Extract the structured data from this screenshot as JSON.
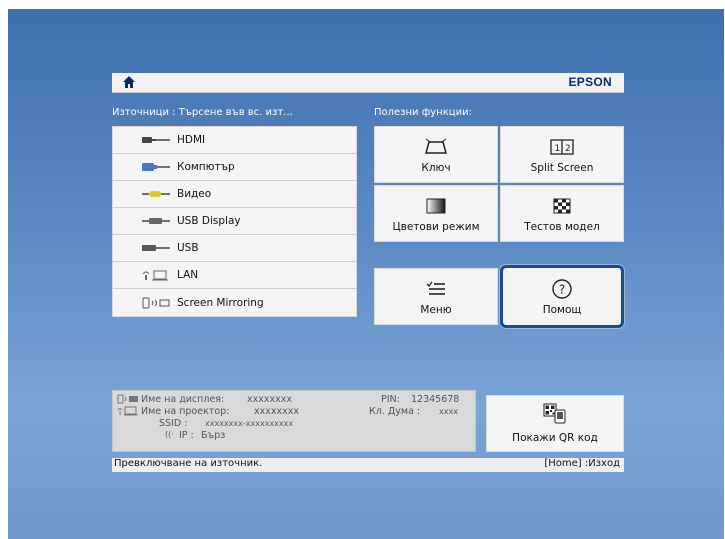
{
  "header": {
    "brand": "EPSON",
    "home_icon": "home-icon"
  },
  "sources": {
    "heading": "Източници : Търсене във вс. изт...",
    "items": [
      {
        "label": "HDMI",
        "icon": "hdmi-icon"
      },
      {
        "label": "Компютър",
        "icon": "computer-icon"
      },
      {
        "label": "Видео",
        "icon": "video-icon"
      },
      {
        "label": "USB Display",
        "icon": "usb-display-icon"
      },
      {
        "label": "USB",
        "icon": "usb-icon"
      },
      {
        "label": "LAN",
        "icon": "lan-icon"
      },
      {
        "label": "Screen Mirroring",
        "icon": "screen-mirroring-icon"
      }
    ]
  },
  "functions": {
    "heading": "Полезни функции:",
    "keystone": "Ключ",
    "split_screen": "Split Screen",
    "color_mode": "Цветови режим",
    "test_pattern": "Тестов модел",
    "menu": "Меню",
    "help": "Помощ",
    "help_icon_glyph": "?",
    "selected": "help"
  },
  "info": {
    "display_name_label": "Име на дисплея:",
    "display_name_value": "xxxxxxxx",
    "projector_name_label": "Име на проектор:",
    "projector_name_value": "xxxxxxxx",
    "ssid_label": "SSID :",
    "ssid_value": "xxxxxxxx-xxxxxxxxxx",
    "ip_label": "IP :",
    "ip_value": "Бърз",
    "pin_label": "PIN:",
    "pin_value": "12345678",
    "keyword_label": "Кл. Дума :",
    "keyword_value": "xxxx"
  },
  "qr": {
    "label": "Покажи QR код"
  },
  "status": {
    "left": "Превключване на източник.",
    "right": "[Home] :Изход"
  },
  "colors": {
    "background_top": "#3f6fae",
    "background_bottom": "#7aa4d6",
    "selection_border": "#1c4a8c",
    "brand_text": "#0a2a6e"
  }
}
